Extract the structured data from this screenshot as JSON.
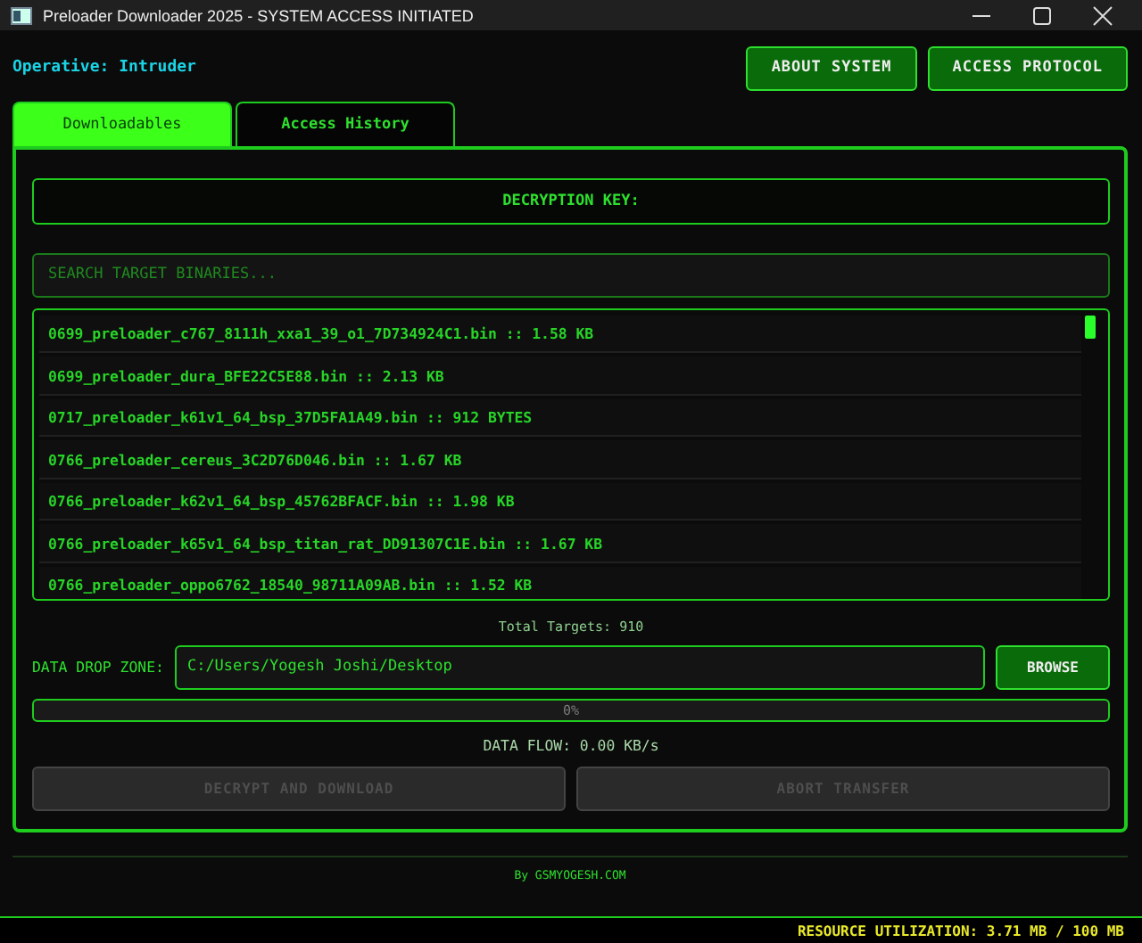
{
  "window": {
    "title": "Preloader Downloader 2025 - SYSTEM ACCESS INITIATED"
  },
  "operative": "Operative: Intruder",
  "header_buttons": [
    "ABOUT SYSTEM",
    "ACCESS PROTOCOL"
  ],
  "tabs": [
    {
      "label": "Downloadables",
      "selected": true
    },
    {
      "label": "Access History",
      "selected": false
    }
  ],
  "decryption_key": "DECRYPTION KEY:",
  "search": {
    "placeholder": "SEARCH TARGET BINARIES..."
  },
  "files": [
    "0699_preloader_c767_8111h_xxa1_39_o1_7D734924C1.bin :: 1.58 KB",
    "0699_preloader_dura_BFE22C5E88.bin :: 2.13 KB",
    "0717_preloader_k61v1_64_bsp_37D5FA1A49.bin :: 912 BYTES",
    "0766_preloader_cereus_3C2D76D046.bin :: 1.67 KB",
    "0766_preloader_k62v1_64_bsp_45762BFACF.bin :: 1.98 KB",
    "0766_preloader_k65v1_64_bsp_titan_rat_DD91307C1E.bin :: 1.67 KB",
    "0766_preloader_oppo6762_18540_98711A09AB.bin :: 1.52 KB"
  ],
  "total": "Total Targets: 910",
  "drop_zone": {
    "label": "DATA DROP ZONE:",
    "value": "C:/Users/Yogesh Joshi/Desktop",
    "button": "BROWSE"
  },
  "progress": {
    "level": 0,
    "reading": "0%"
  },
  "data_flow": "DATA FLOW: 0.00 KB/s",
  "actions": [
    {
      "label": "DECRYPT AND DOWNLOAD",
      "disabled": true
    },
    {
      "label": "ABORT TRANSFER",
      "disabled": true
    }
  ],
  "footer": "By GSMYOGESH.COM",
  "status_bar": "RESOURCE UTILIZATION: 3.71 MB / 100 MB"
}
